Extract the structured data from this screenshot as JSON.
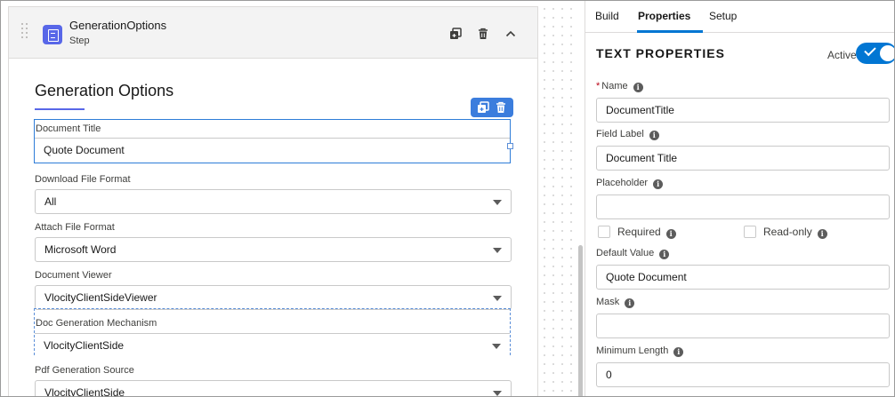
{
  "step": {
    "title": "GenerationOptions",
    "subtitle": "Step",
    "icons": [
      "drag-handle-icon",
      "duplicate-icon",
      "delete-icon",
      "chevron-up-icon"
    ]
  },
  "canvas": {
    "section_title": "Generation Options",
    "fields": [
      {
        "label": "Document Title",
        "value": "Quote Document",
        "type": "text"
      },
      {
        "label": "Download File Format",
        "value": "All",
        "type": "select"
      },
      {
        "label": "Attach File Format",
        "value": "Microsoft Word",
        "type": "select"
      },
      {
        "label": "Document Viewer",
        "value": "VlocityClientSideViewer",
        "type": "select"
      },
      {
        "label": "Doc Generation Mechanism",
        "value": "VlocityClientSide",
        "type": "select"
      },
      {
        "label": "Pdf Generation Source",
        "value": "VlocityClientSide",
        "type": "select"
      }
    ]
  },
  "right_panel": {
    "tabs": [
      "Build",
      "Properties",
      "Setup"
    ],
    "active_tab": "Properties",
    "title": "TEXT PROPERTIES",
    "active_label": "Active",
    "active_on": true,
    "name": {
      "label": "Name",
      "required_mark": "*",
      "value": "DocumentTitle"
    },
    "field_label": {
      "label": "Field Label",
      "value": "Document Title"
    },
    "placeholder": {
      "label": "Placeholder",
      "value": ""
    },
    "required": {
      "label": "Required",
      "checked": false
    },
    "read_only": {
      "label": "Read-only",
      "checked": false
    },
    "default_value": {
      "label": "Default Value",
      "value": "Quote Document"
    },
    "mask": {
      "label": "Mask",
      "value": ""
    },
    "minimum_length": {
      "label": "Minimum Length",
      "value": "0"
    }
  },
  "colors": {
    "accent": "#0176d3",
    "step_icon": "#5867e8",
    "selection": "#2e7cd8"
  }
}
